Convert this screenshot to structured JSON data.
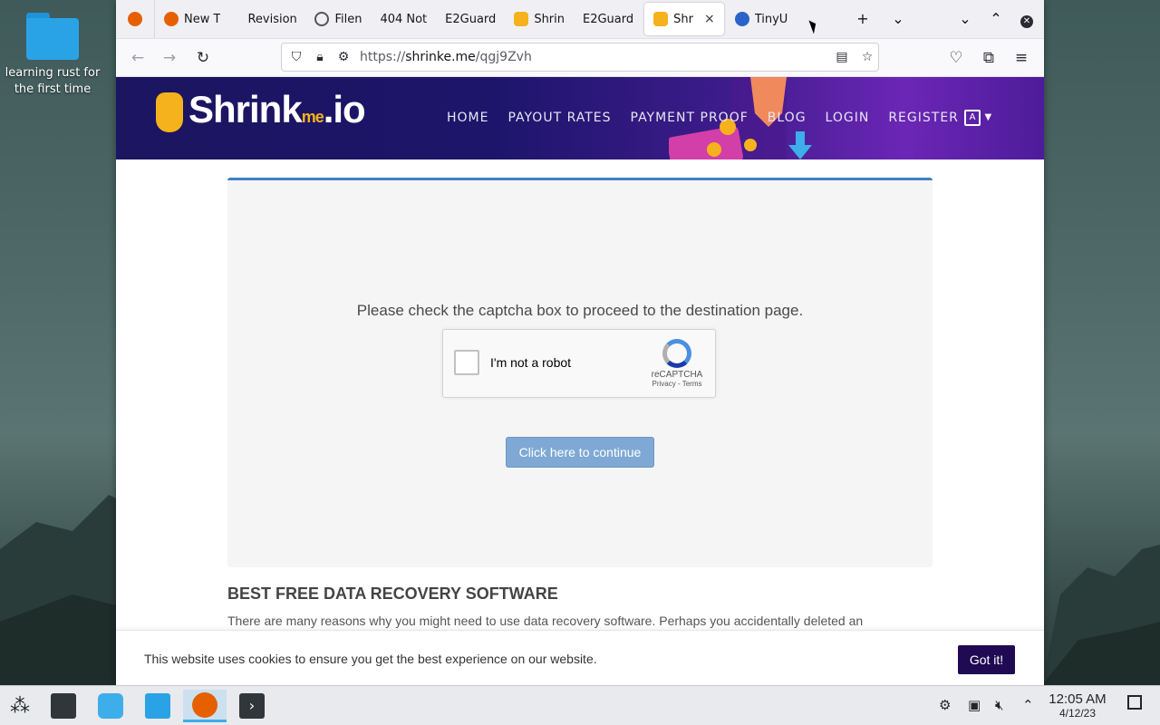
{
  "desktop": {
    "icon_label": "learning rust for the first time"
  },
  "browser": {
    "tabs": [
      {
        "title": "",
        "favicon_color": "#e66000",
        "active": false
      },
      {
        "title": "New T",
        "favicon_color": "#e66000",
        "active": false
      },
      {
        "title": "Revision",
        "favicon_color": "",
        "active": false
      },
      {
        "title": "Filen",
        "favicon_color": "#555555",
        "active": false
      },
      {
        "title": "404 Not",
        "favicon_color": "",
        "active": false
      },
      {
        "title": "E2Guard",
        "favicon_color": "",
        "active": false
      },
      {
        "title": "Shrin",
        "favicon_color": "#f5b21c",
        "active": false
      },
      {
        "title": "E2Guard",
        "favicon_color": "",
        "active": false
      },
      {
        "title": "Shr",
        "favicon_color": "#f5b21c",
        "active": true
      },
      {
        "title": "TinyU",
        "favicon_color": "#2a64c8",
        "active": false
      }
    ],
    "close_tab_glyph": "×",
    "url_prefix": "https://",
    "url_domain": "shrinke.me",
    "url_path": "/qgj9Zvh"
  },
  "site": {
    "logo_text": "Shrink",
    "logo_me": "me",
    "logo_tld": ".io",
    "menu": [
      "HOME",
      "PAYOUT RATES",
      "PAYMENT PROOF",
      "BLOG",
      "LOGIN",
      "REGISTER"
    ],
    "lang_icon": "translate-icon"
  },
  "captcha": {
    "message": "Please check the captcha box to proceed to the destination page.",
    "checkbox_label": "I'm not a robot",
    "brand": "reCAPTCHA",
    "terms": "Privacy - Terms",
    "continue_label": "Click here to continue"
  },
  "article": {
    "title": "BEST FREE DATA RECOVERY SOFTWARE",
    "body": "There are many reasons why you might need to use data recovery software. Perhaps you accidentally deleted an"
  },
  "cookie": {
    "text": "This website uses cookies to ensure you get the best experience on our website.",
    "button": "Got it!"
  },
  "taskbar": {
    "time": "12:05 AM",
    "date": "4/12/23"
  },
  "colors": {
    "accent_blue": "#3c82c4",
    "cookie_button": "#200a54",
    "continue_button": "#7fa9d4"
  }
}
